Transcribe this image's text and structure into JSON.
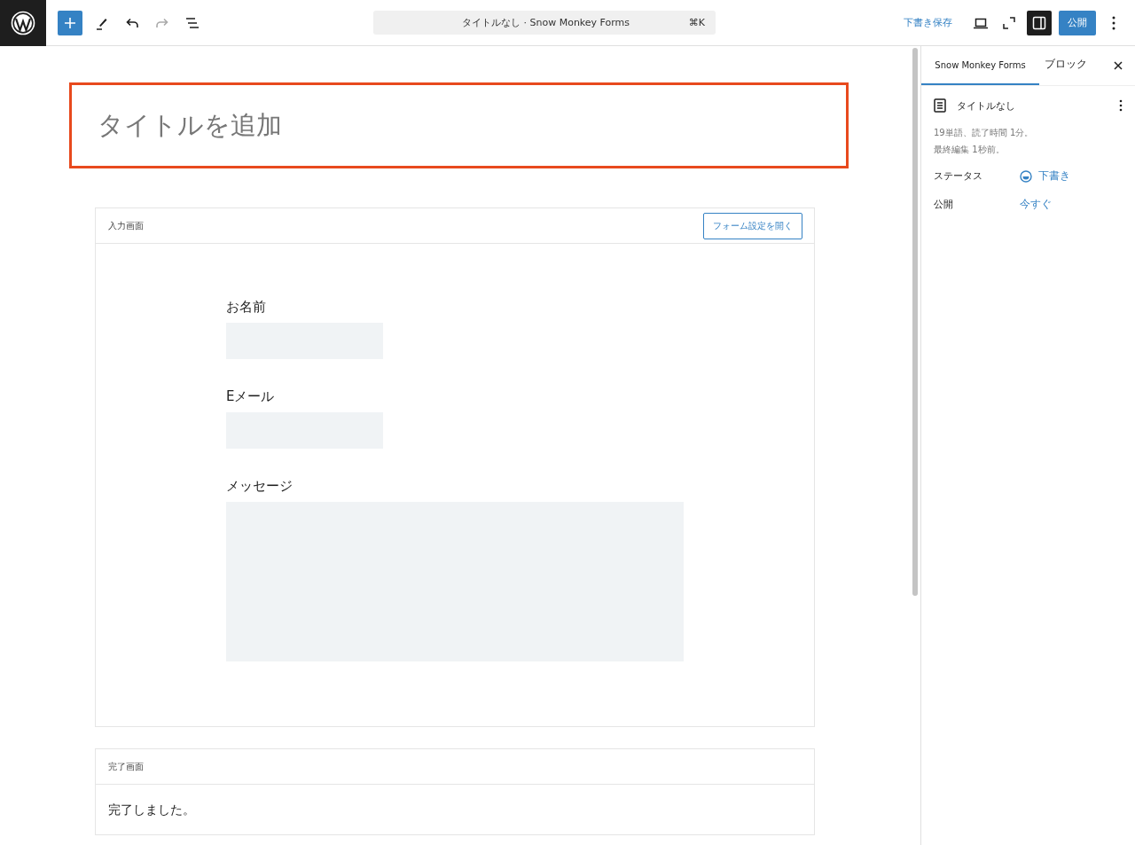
{
  "toolbar": {
    "tools": [
      {
        "kind": "add",
        "disabled": false
      },
      {
        "kind": "pen",
        "disabled": false
      },
      {
        "kind": "undo",
        "disabled": false
      },
      {
        "kind": "redo",
        "disabled": true
      },
      {
        "kind": "list-view",
        "disabled": false
      }
    ],
    "command_bar": {
      "title": "タイトルなし · Snow Monkey Forms",
      "shortcut": "⌘K"
    },
    "save_draft": "下書き保存",
    "settings_pressed": true,
    "publish": "公開"
  },
  "editor": {
    "title_placeholder": "タイトルを追加",
    "title_highlighted": true,
    "blocks": [
      {
        "kind": "input",
        "label": "入力画面",
        "button": "フォーム設定を開く",
        "fields": [
          {
            "label": "お名前",
            "kind": "text"
          },
          {
            "label": "Eメール",
            "kind": "text"
          },
          {
            "label": "メッセージ",
            "kind": "textarea"
          }
        ]
      },
      {
        "kind": "complete",
        "label": "完了画面",
        "message": "完了しました。"
      }
    ]
  },
  "sidebar": {
    "tabs": [
      {
        "label": "Snow Monkey Forms",
        "selected": true
      },
      {
        "label": "ブロック",
        "selected": false
      }
    ],
    "document_title": "タイトルなし",
    "stats": [
      "19単語、読了時間 1分。",
      "最終編集 1秒前。"
    ],
    "rows": [
      {
        "kind": "status",
        "label": "ステータス",
        "value": "下書き"
      },
      {
        "kind": "publish",
        "label": "公開",
        "value": "今すぐ"
      }
    ]
  }
}
